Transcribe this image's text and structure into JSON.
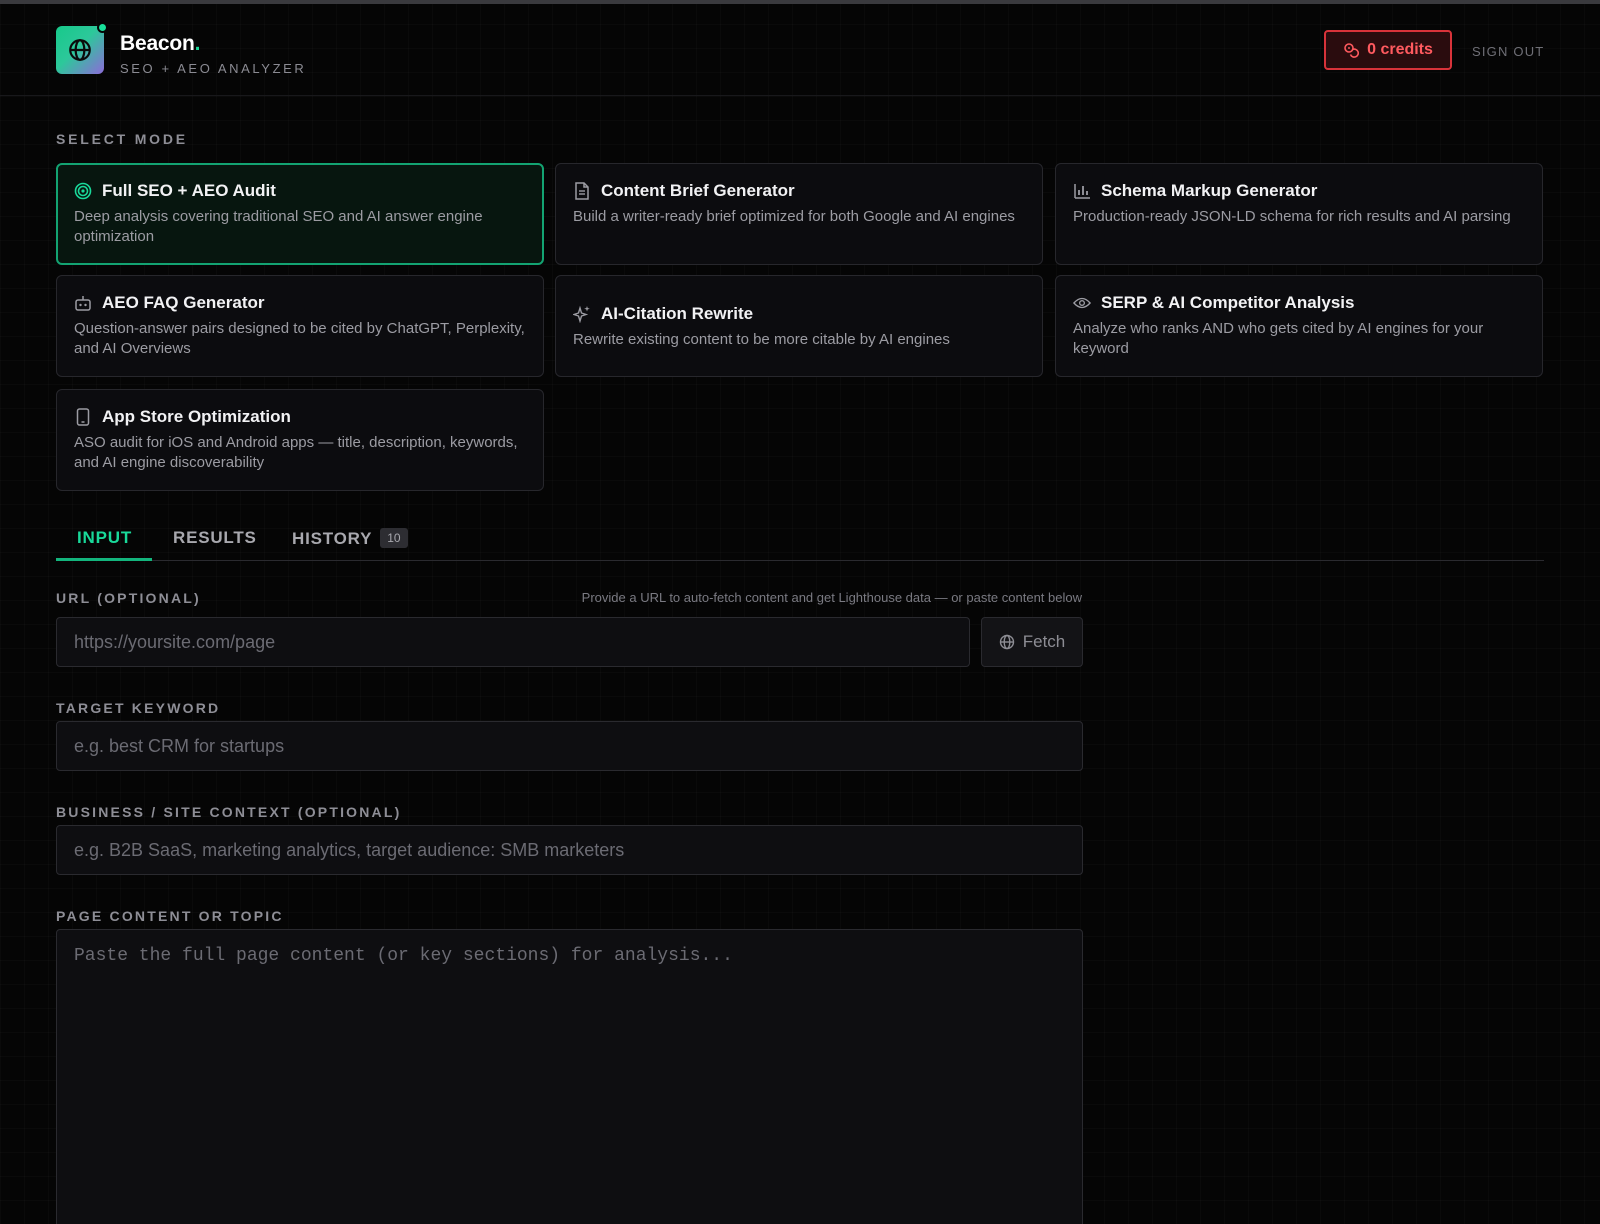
{
  "header": {
    "brand_name": "Beacon",
    "brand_dot": ".",
    "brand_subtitle": "SEO + AEO ANALYZER",
    "credits_label": "0 credits",
    "signout_label": "SIGN OUT"
  },
  "mode_section": {
    "label": "SELECT MODE",
    "modes": [
      {
        "title": "Full SEO + AEO Audit",
        "desc": "Deep analysis covering traditional SEO and AI answer engine optimization",
        "icon": "target-icon",
        "selected": true
      },
      {
        "title": "Content Brief Generator",
        "desc": "Build a writer-ready brief optimized for both Google and AI engines",
        "icon": "document-icon",
        "selected": false
      },
      {
        "title": "Schema Markup Generator",
        "desc": "Production-ready JSON-LD schema for rich results and AI parsing",
        "icon": "bar-chart-icon",
        "selected": false
      },
      {
        "title": "AEO FAQ Generator",
        "desc": "Question-answer pairs designed to be cited by ChatGPT, Perplexity, and AI Overviews",
        "icon": "robot-icon",
        "selected": false
      },
      {
        "title": "AI-Citation Rewrite",
        "desc": "Rewrite existing content to be more citable by AI engines",
        "icon": "sparkle-icon",
        "selected": false
      },
      {
        "title": "SERP & AI Competitor Analysis",
        "desc": "Analyze who ranks AND who gets cited by AI engines for your keyword",
        "icon": "eye-icon",
        "selected": false
      },
      {
        "title": "App Store Optimization",
        "desc": "ASO audit for iOS and Android apps — title, description, keywords, and AI engine discoverability",
        "icon": "phone-icon",
        "selected": false
      }
    ]
  },
  "tabs": [
    {
      "label": "INPUT",
      "active": true
    },
    {
      "label": "RESULTS",
      "active": false
    },
    {
      "label": "HISTORY",
      "active": false,
      "badge": "10"
    }
  ],
  "form": {
    "url_label": "URL (OPTIONAL)",
    "url_hint": "Provide a URL to auto-fetch content and get Lighthouse data — or paste content below",
    "url_placeholder": "https://yoursite.com/page",
    "fetch_label": "Fetch",
    "keyword_label": "TARGET KEYWORD",
    "keyword_placeholder": "e.g. best CRM for startups",
    "context_label": "BUSINESS / SITE CONTEXT (OPTIONAL)",
    "context_placeholder": "e.g. B2B SaaS, marketing analytics, target audience: SMB marketers",
    "content_label": "PAGE CONTENT OR TOPIC",
    "content_placeholder": "Paste the full page content (or key sections) for analysis..."
  },
  "colors": {
    "accent": "#19d99a",
    "danger": "#ff5a5f",
    "background": "#050505"
  }
}
